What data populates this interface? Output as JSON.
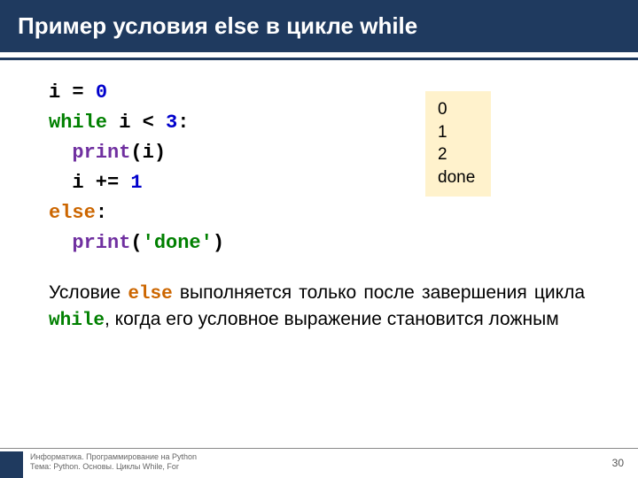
{
  "header": {
    "title": "Пример условия else в цикле while"
  },
  "code": {
    "l1a": "i = ",
    "l1b": "0",
    "l2a": "while",
    "l2b": " i < ",
    "l2c": "3",
    "l2d": ":",
    "l3a": "  ",
    "l3b": "print",
    "l3c": "(i)",
    "l4a": "  i += ",
    "l4b": "1",
    "l5a": "else",
    "l5b": ":",
    "l6a": "  ",
    "l6b": "print",
    "l6c": "(",
    "l6d": "'done'",
    "l6e": ")"
  },
  "output": {
    "l1": "0",
    "l2": "1",
    "l3": "2",
    "l4": "done"
  },
  "explain": {
    "t1": "Условие ",
    "els": "else",
    "t2": " выполняется только после завершения цикла ",
    "whl": "while",
    "t3": ", когда его условное выражение становится ложным"
  },
  "footer": {
    "line1": "Информатика. Программирование на Python",
    "line2": "Тема: Python. Основы. Циклы While, For",
    "page": "30"
  }
}
